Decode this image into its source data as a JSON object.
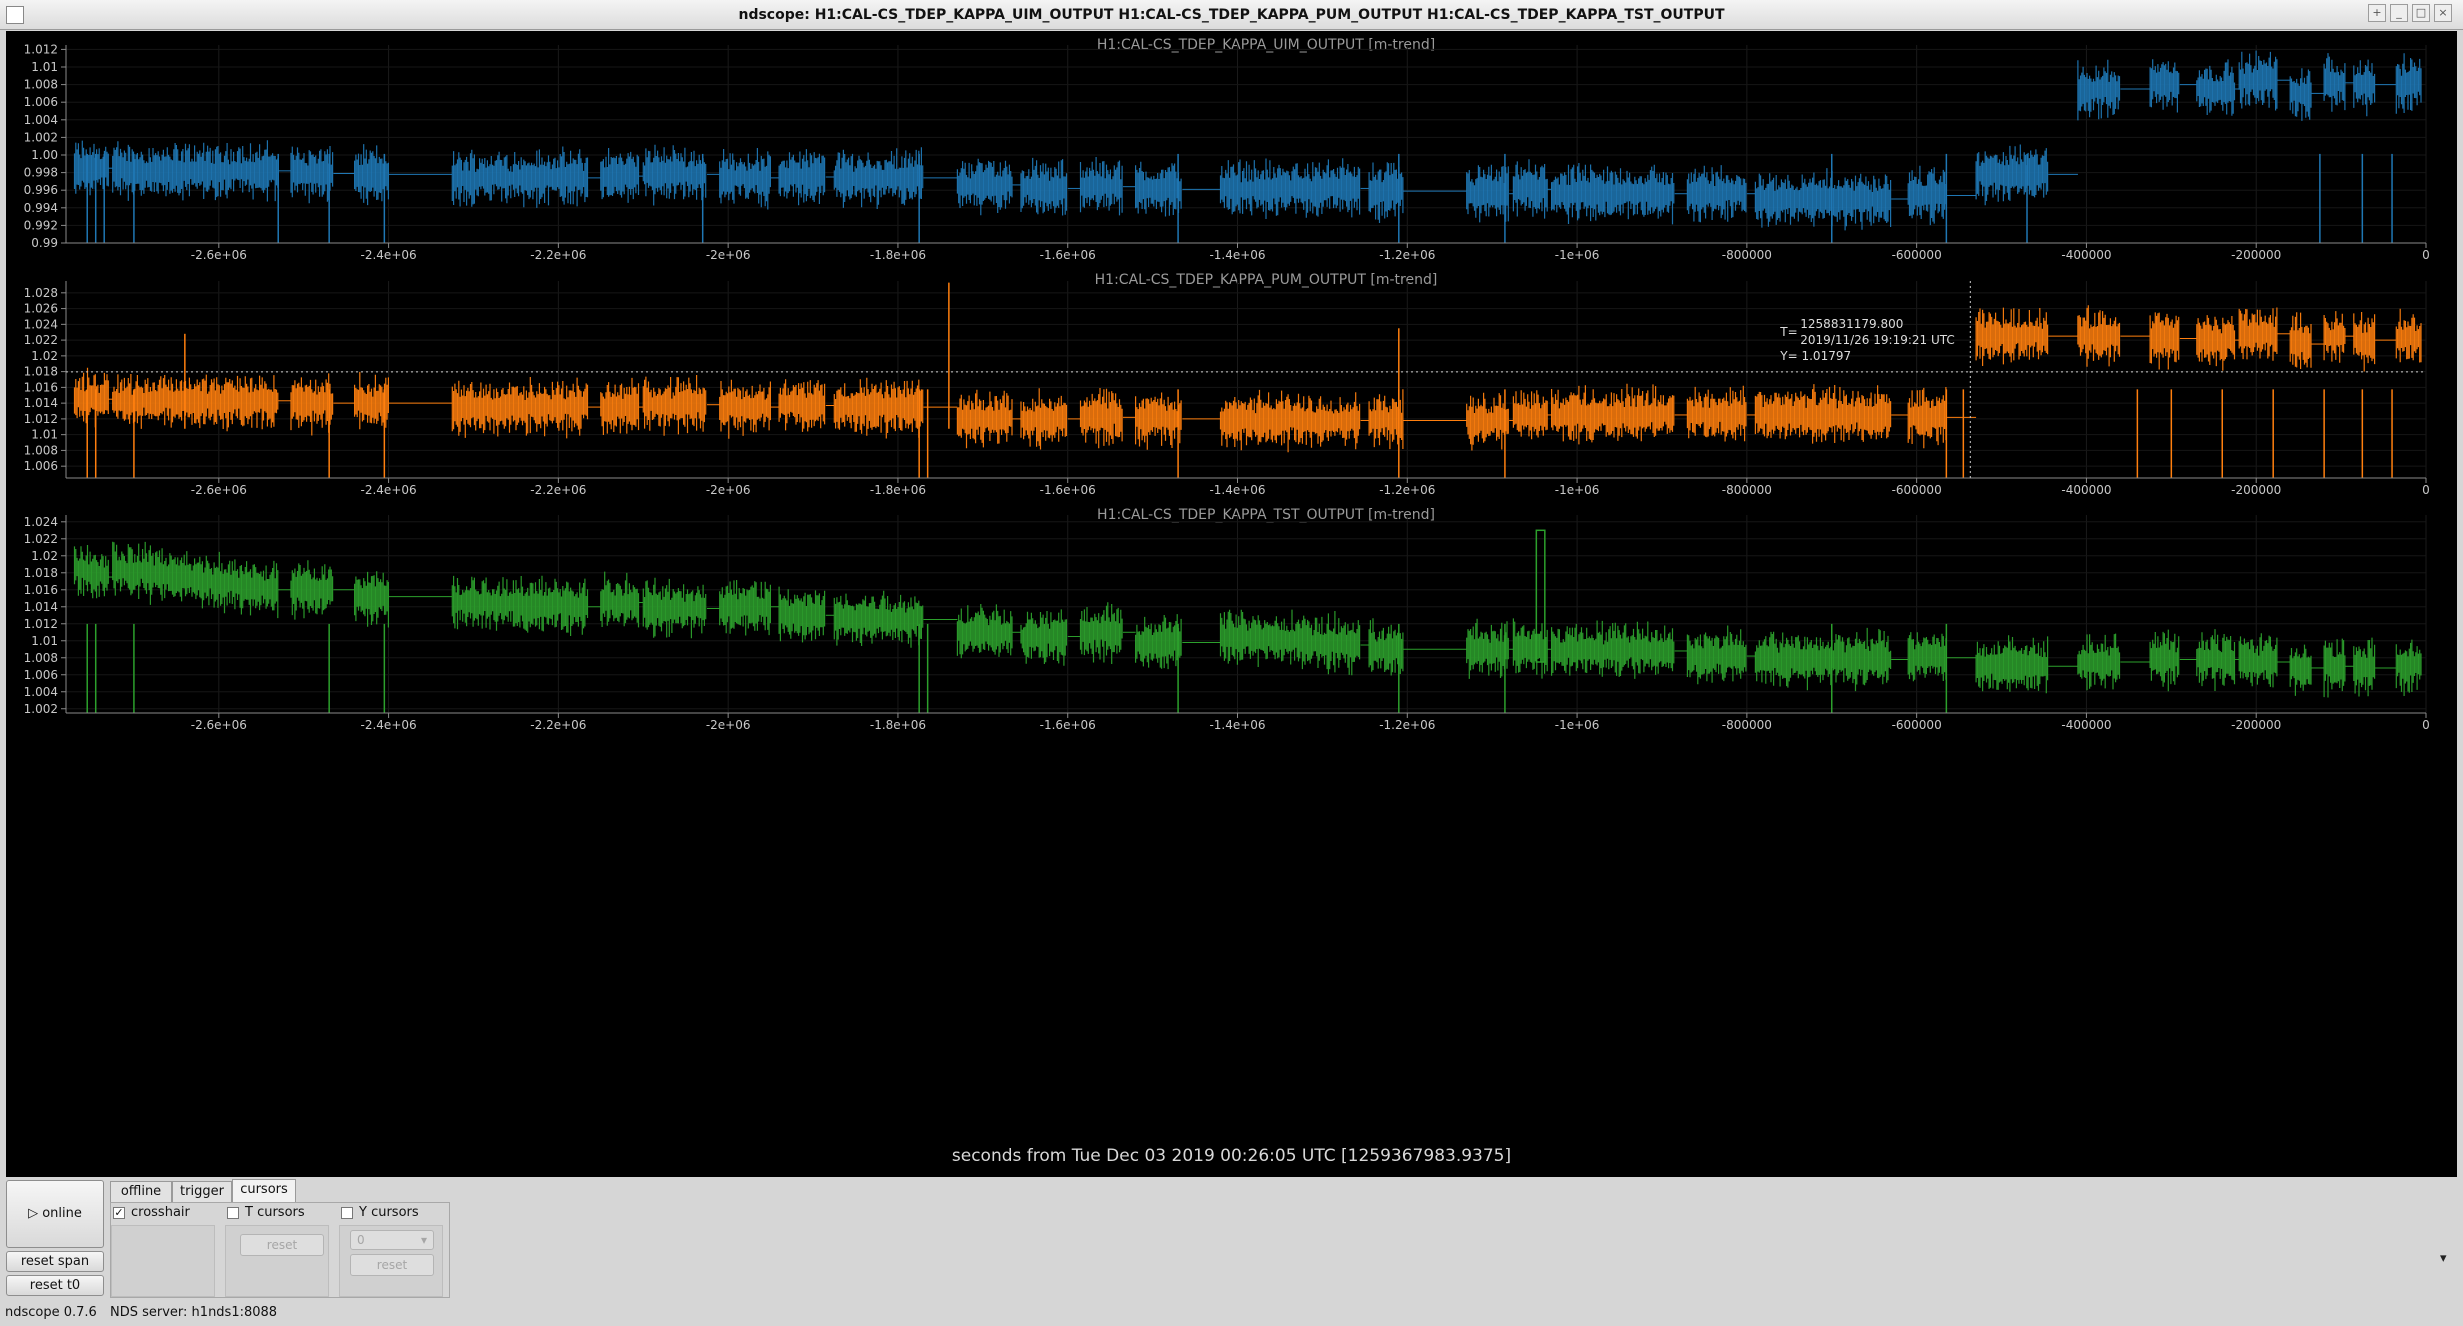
{
  "window": {
    "title": "ndscope: H1:CAL-CS_TDEP_KAPPA_UIM_OUTPUT H1:CAL-CS_TDEP_KAPPA_PUM_OUTPUT H1:CAL-CS_TDEP_KAPPA_TST_OUTPUT"
  },
  "x_caption": "seconds from Tue Dec 03 2019 00:26:05 UTC [1259367983.9375]",
  "cursor_readout": {
    "t_label": "T=",
    "t_value": "1258831179.800",
    "t_date": "2019/11/26 19:19:21 UTC",
    "y_text": "Y= 1.01797"
  },
  "controls": {
    "online_label": "▷ online",
    "reset_span_label": "reset span",
    "reset_t0_label": "reset t0",
    "tabs": [
      "offline",
      "trigger",
      "cursors"
    ],
    "active_tab": "cursors",
    "crosshair_label": "crosshair",
    "crosshair_checked": "✓",
    "t_cursors_label": "T cursors",
    "y_cursors_label": "Y cursors",
    "t_reset_label": "reset",
    "y_select_value": "0",
    "y_reset_label": "reset",
    "overflow_arrow": "▾"
  },
  "status": {
    "version": "ndscope 0.7.6",
    "server": "NDS server: h1nds1:8088"
  },
  "chart_data": [
    {
      "type": "line",
      "title": "H1:CAL-CS_TDEP_KAPPA_UIM_OUTPUT [m-trend]",
      "color": "#1f77b4",
      "xlim": [
        -2780000,
        0
      ],
      "ylim": [
        0.99,
        1.0125
      ],
      "yticks": [
        "0.99",
        "0.992",
        "0.994",
        "0.996",
        "0.998",
        "1.00",
        "1.002",
        "1.004",
        "1.006",
        "1.008",
        "1.01",
        "1.012"
      ],
      "xticks": [
        "-2.6e+06",
        "-2.4e+06",
        "-2.2e+06",
        "-2e+06",
        "-1.8e+06",
        "-1.6e+06",
        "-1.4e+06",
        "-1.2e+06",
        "-1e+06",
        "-800000",
        "-600000",
        "-400000",
        "-200000",
        "0"
      ],
      "xtick_values": [
        -2600000,
        -2400000,
        -2200000,
        -2000000,
        -1800000,
        -1600000,
        -1400000,
        -1200000,
        -1000000,
        -800000,
        -600000,
        -400000,
        -200000,
        0
      ],
      "segments": [
        {
          "x": [
            -2770000,
            -2730000
          ],
          "y": 0.9985
        },
        {
          "x": [
            -2725000,
            -2530000
          ],
          "y": 0.9982
        },
        {
          "x": [
            -2515000,
            -2465000
          ],
          "y": 0.9979
        },
        {
          "x": [
            -2440000,
            -2400000
          ],
          "y": 0.9978
        },
        {
          "x": [
            -2325000,
            -2165000
          ],
          "y": 0.9974
        },
        {
          "x": [
            -2150000,
            -2105000
          ],
          "y": 0.9976
        },
        {
          "x": [
            -2100000,
            -2025000
          ],
          "y": 0.9978
        },
        {
          "x": [
            -2010000,
            -1950000
          ],
          "y": 0.9974
        },
        {
          "x": [
            -1940000,
            -1885000
          ],
          "y": 0.9975
        },
        {
          "x": [
            -1875000,
            -1770000
          ],
          "y": 0.9974
        },
        {
          "x": [
            -1730000,
            -1665000
          ],
          "y": 0.9966
        },
        {
          "x": [
            -1655000,
            -1600000
          ],
          "y": 0.9962
        },
        {
          "x": [
            -1585000,
            -1535000
          ],
          "y": 0.9964
        },
        {
          "x": [
            -1520000,
            -1465000
          ],
          "y": 0.9961
        },
        {
          "x": [
            -1420000,
            -1255000
          ],
          "y": 0.9962
        },
        {
          "x": [
            -1245000,
            -1205000
          ],
          "y": 0.9959
        },
        {
          "x": [
            -1130000,
            -1080000
          ],
          "y": 0.9956
        },
        {
          "x": [
            -1075000,
            -1035000
          ],
          "y": 0.9961
        },
        {
          "x": [
            -1030000,
            -885000
          ],
          "y": 0.9956
        },
        {
          "x": [
            -870000,
            -800000
          ],
          "y": 0.9956
        },
        {
          "x": [
            -790000,
            -630000
          ],
          "y": 0.995
        },
        {
          "x": [
            -610000,
            -565000
          ],
          "y": 0.9954
        },
        {
          "x": [
            -530000,
            -445000
          ],
          "y": 0.9978
        },
        {
          "x": [
            -410000,
            -360000
          ],
          "y": 1.0075
        },
        {
          "x": [
            -325000,
            -290000
          ],
          "y": 1.008
        },
        {
          "x": [
            -270000,
            -225000
          ],
          "y": 1.0075
        },
        {
          "x": [
            -220000,
            -175000
          ],
          "y": 1.0085
        },
        {
          "x": [
            -160000,
            -135000
          ],
          "y": 1.007
        },
        {
          "x": [
            -120000,
            -95000
          ],
          "y": 1.0082
        },
        {
          "x": [
            -85000,
            -60000
          ],
          "y": 1.008
        },
        {
          "x": [
            -35000,
            -5000
          ],
          "y": 1.008
        }
      ],
      "spikes": [
        -2755000,
        -2745000,
        -2735000,
        -2700000,
        -2530000,
        -2470000,
        -2405000,
        -2030000,
        -1775000,
        -1470000,
        -1210000,
        -1085000,
        -700000,
        -565000,
        -470000,
        -125000,
        -75000,
        -40000
      ]
    },
    {
      "type": "line",
      "title": "H1:CAL-CS_TDEP_KAPPA_PUM_OUTPUT [m-trend]",
      "color": "#ff7f0e",
      "xlim": [
        -2780000,
        0
      ],
      "ylim": [
        1.0045,
        1.0295
      ],
      "yticks": [
        "1.006",
        "1.008",
        "1.01",
        "1.012",
        "1.014",
        "1.016",
        "1.018",
        "1.02",
        "1.022",
        "1.024",
        "1.026",
        "1.028"
      ],
      "xticks": [
        "-2.6e+06",
        "-2.4e+06",
        "-2.2e+06",
        "-2e+06",
        "-1.8e+06",
        "-1.6e+06",
        "-1.4e+06",
        "-1.2e+06",
        "-1e+06",
        "-800000",
        "-600000",
        "-400000",
        "-200000",
        "0"
      ],
      "xtick_values": [
        -2600000,
        -2400000,
        -2200000,
        -2000000,
        -1800000,
        -1600000,
        -1400000,
        -1200000,
        -1000000,
        -800000,
        -600000,
        -400000,
        -200000,
        0
      ],
      "segments": [
        {
          "x": [
            -2770000,
            -2730000
          ],
          "y": 1.0145
        },
        {
          "x": [
            -2725000,
            -2530000
          ],
          "y": 1.0143
        },
        {
          "x": [
            -2515000,
            -2465000
          ],
          "y": 1.014
        },
        {
          "x": [
            -2440000,
            -2400000
          ],
          "y": 1.014
        },
        {
          "x": [
            -2325000,
            -2165000
          ],
          "y": 1.0135
        },
        {
          "x": [
            -2150000,
            -2105000
          ],
          "y": 1.0135
        },
        {
          "x": [
            -2100000,
            -2025000
          ],
          "y": 1.0138
        },
        {
          "x": [
            -2010000,
            -1950000
          ],
          "y": 1.0135
        },
        {
          "x": [
            -1940000,
            -1885000
          ],
          "y": 1.0137
        },
        {
          "x": [
            -1875000,
            -1770000
          ],
          "y": 1.0135
        },
        {
          "x": [
            -1730000,
            -1665000
          ],
          "y": 1.012
        },
        {
          "x": [
            -1655000,
            -1600000
          ],
          "y": 1.012
        },
        {
          "x": [
            -1585000,
            -1535000
          ],
          "y": 1.0122
        },
        {
          "x": [
            -1520000,
            -1465000
          ],
          "y": 1.012
        },
        {
          "x": [
            -1420000,
            -1255000
          ],
          "y": 1.0118
        },
        {
          "x": [
            -1245000,
            -1205000
          ],
          "y": 1.0118
        },
        {
          "x": [
            -1130000,
            -1080000
          ],
          "y": 1.0118
        },
        {
          "x": [
            -1075000,
            -1035000
          ],
          "y": 1.0125
        },
        {
          "x": [
            -1030000,
            -885000
          ],
          "y": 1.0125
        },
        {
          "x": [
            -870000,
            -800000
          ],
          "y": 1.0125
        },
        {
          "x": [
            -790000,
            -630000
          ],
          "y": 1.0125
        },
        {
          "x": [
            -610000,
            -565000
          ],
          "y": 1.0122
        },
        {
          "x": [
            -530000,
            -445000
          ],
          "y": 1.0225
        },
        {
          "x": [
            -410000,
            -360000
          ],
          "y": 1.0225
        },
        {
          "x": [
            -325000,
            -290000
          ],
          "y": 1.0222
        },
        {
          "x": [
            -270000,
            -225000
          ],
          "y": 1.022
        },
        {
          "x": [
            -220000,
            -175000
          ],
          "y": 1.0228
        },
        {
          "x": [
            -160000,
            -135000
          ],
          "y": 1.0215
        },
        {
          "x": [
            -120000,
            -95000
          ],
          "y": 1.0225
        },
        {
          "x": [
            -85000,
            -60000
          ],
          "y": 1.022
        },
        {
          "x": [
            -35000,
            -5000
          ],
          "y": 1.0222
        }
      ],
      "spikes": [
        -2755000,
        -2745000,
        -2700000,
        -2470000,
        -2405000,
        -1775000,
        -1765000,
        -1470000,
        -1210000,
        -1085000,
        -565000,
        -545000,
        -340000,
        -300000,
        -240000,
        -180000,
        -120000,
        -75000,
        -40000
      ],
      "up_spikes": [
        {
          "x": -1740000,
          "y": 1.0293
        },
        {
          "x": -1210000,
          "y": 1.0235
        },
        {
          "x": -2640000,
          "y": 1.0228
        }
      ],
      "crosshair": {
        "x": -536804,
        "y": 1.01797
      }
    },
    {
      "type": "line",
      "title": "H1:CAL-CS_TDEP_KAPPA_TST_OUTPUT [m-trend]",
      "color": "#2ca02c",
      "xlim": [
        -2780000,
        0
      ],
      "ylim": [
        1.0015,
        1.0248
      ],
      "yticks": [
        "1.002",
        "1.004",
        "1.006",
        "1.008",
        "1.01",
        "1.012",
        "1.014",
        "1.016",
        "1.018",
        "1.02",
        "1.022",
        "1.024"
      ],
      "xticks": [
        "-2.6e+06",
        "-2.4e+06",
        "-2.2e+06",
        "-2e+06",
        "-1.8e+06",
        "-1.6e+06",
        "-1.4e+06",
        "-1.2e+06",
        "-1e+06",
        "-800000",
        "-600000",
        "-400000",
        "-200000",
        "0"
      ],
      "xtick_values": [
        -2600000,
        -2400000,
        -2200000,
        -2000000,
        -1800000,
        -1600000,
        -1400000,
        -1200000,
        -1000000,
        -800000,
        -600000,
        -400000,
        -200000,
        0
      ],
      "segments": [
        {
          "x": [
            -2770000,
            -2730000
          ],
          "y": 1.0185,
          "y_end": 1.0175
        },
        {
          "x": [
            -2725000,
            -2530000
          ],
          "y": 1.0185,
          "y_end": 1.016
        },
        {
          "x": [
            -2515000,
            -2465000
          ],
          "y": 1.016
        },
        {
          "x": [
            -2440000,
            -2400000
          ],
          "y": 1.0152
        },
        {
          "x": [
            -2325000,
            -2165000
          ],
          "y": 1.0145,
          "y_end": 1.014
        },
        {
          "x": [
            -2150000,
            -2105000
          ],
          "y": 1.0145
        },
        {
          "x": [
            -2100000,
            -2025000
          ],
          "y": 1.0138
        },
        {
          "x": [
            -2010000,
            -1950000
          ],
          "y": 1.014
        },
        {
          "x": [
            -1940000,
            -1885000
          ],
          "y": 1.013
        },
        {
          "x": [
            -1875000,
            -1770000
          ],
          "y": 1.0125
        },
        {
          "x": [
            -1730000,
            -1665000
          ],
          "y": 1.011
        },
        {
          "x": [
            -1655000,
            -1600000
          ],
          "y": 1.0105
        },
        {
          "x": [
            -1585000,
            -1535000
          ],
          "y": 1.011
        },
        {
          "x": [
            -1520000,
            -1465000
          ],
          "y": 1.0098
        },
        {
          "x": [
            -1420000,
            -1255000
          ],
          "y": 1.0105,
          "y_end": 1.0095
        },
        {
          "x": [
            -1245000,
            -1205000
          ],
          "y": 1.009
        },
        {
          "x": [
            -1130000,
            -1080000
          ],
          "y": 1.009
        },
        {
          "x": [
            -1075000,
            -1035000
          ],
          "y": 1.009
        },
        {
          "x": [
            -1030000,
            -885000
          ],
          "y": 1.0088
        },
        {
          "x": [
            -870000,
            -800000
          ],
          "y": 1.0082
        },
        {
          "x": [
            -790000,
            -630000
          ],
          "y": 1.0078
        },
        {
          "x": [
            -610000,
            -565000
          ],
          "y": 1.008
        },
        {
          "x": [
            -530000,
            -445000
          ],
          "y": 1.007
        },
        {
          "x": [
            -410000,
            -360000
          ],
          "y": 1.0075
        },
        {
          "x": [
            -325000,
            -290000
          ],
          "y": 1.0078
        },
        {
          "x": [
            -270000,
            -225000
          ],
          "y": 1.0078
        },
        {
          "x": [
            -220000,
            -175000
          ],
          "y": 1.0075
        },
        {
          "x": [
            -160000,
            -135000
          ],
          "y": 1.0068
        },
        {
          "x": [
            -120000,
            -95000
          ],
          "y": 1.007
        },
        {
          "x": [
            -85000,
            -60000
          ],
          "y": 1.0068
        },
        {
          "x": [
            -35000,
            -5000
          ],
          "y": 1.007
        }
      ],
      "spikes": [
        -2755000,
        -2745000,
        -2700000,
        -2470000,
        -2405000,
        -1775000,
        -1765000,
        -1470000,
        -1210000,
        -1085000,
        -700000,
        -565000
      ],
      "rect": {
        "x": [
          -1048000,
          -1038000
        ],
        "y": [
          1.0075,
          1.023
        ]
      }
    }
  ]
}
